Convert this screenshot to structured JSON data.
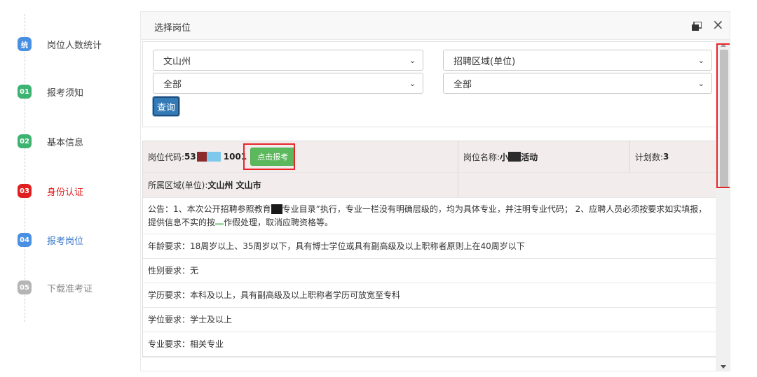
{
  "steps": [
    {
      "num": "统",
      "label": "岗位人数统计",
      "color": "#4a90e2",
      "text_color": "#444444"
    },
    {
      "num": "01",
      "label": "报考须知",
      "color": "#3cb371",
      "text_color": "#444444"
    },
    {
      "num": "02",
      "label": "基本信息",
      "color": "#3cb371",
      "text_color": "#444444"
    },
    {
      "num": "03",
      "label": "身份认证",
      "color": "#e02020",
      "text_color": "#e02020"
    },
    {
      "num": "04",
      "label": "报考岗位",
      "color": "#4a90e2",
      "text_color": "#3a78c8"
    },
    {
      "num": "05",
      "label": "下载准考证",
      "color": "#b5b5b5",
      "text_color": "#888888"
    }
  ],
  "dialog": {
    "title": "选择岗位",
    "maximize_icon": "maximize-icon",
    "close_icon": "close-icon",
    "close_glyph": "×"
  },
  "filters": {
    "prefecture": "文山州",
    "region_type": "招聘区域(单位)",
    "county": "全部",
    "unit": "全部",
    "query_label": "查询",
    "chevron_glyph": "⌄"
  },
  "position": {
    "code_label": "岗位代码:",
    "code_prefix": "53",
    "code_suffix": "1001",
    "apply_label": "点击报考",
    "name_label": "岗位名称:",
    "name_prefix": "小",
    "name_suffix": "活动",
    "plan_label": "计划数:",
    "plan_value": "3",
    "region_label": "所属区域(单位):",
    "region_value": "文山州 文山市"
  },
  "notice": {
    "part1": "公告：1、本次公开招聘参照教育",
    "part2": "专业目录”执行，专业一栏没有明确层级的，均为具体专业，并注明专业代码； 2、应聘人员必须按要求如实填报，提供信息不实的按",
    "part3": "作假处理，取消应聘资格等。"
  },
  "requirements": [
    "年龄要求：18周岁以上、35周岁以下，具有博士学位或具有副高级及以上职称者原则上在40周岁以下",
    "性别要求：无",
    "学历要求：本科及以上，具有副高级及以上职称者学历可放宽至专科",
    "学位要求：学士及以上",
    "专业要求：相关专业"
  ],
  "colors": {
    "accent_blue": "#337ab7",
    "apply_green": "#5cb85c",
    "highlight_red": "#e8262a"
  }
}
